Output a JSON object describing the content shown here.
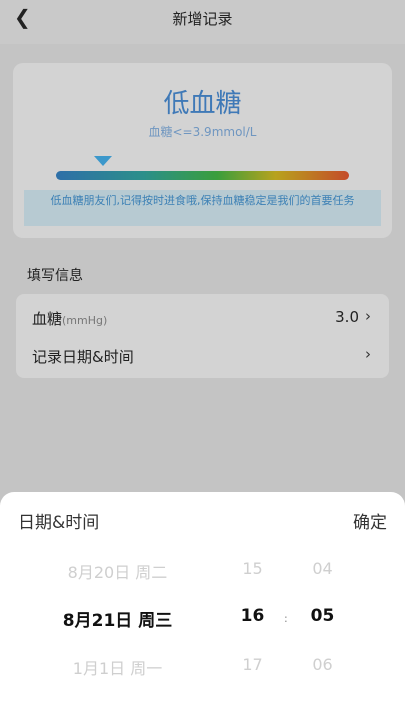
{
  "header": {
    "back_icon": "back-arrow-icon",
    "title": "新增记录"
  },
  "status": {
    "title": "低血糖",
    "range": "血糖<=3.9mmol/L",
    "tip": "低血糖朋友们,记得按时进食哦,保持血糖稳定是我们的首要任务",
    "level_fraction": 0.16
  },
  "form": {
    "section_label": "填写信息",
    "glucose_label": "血糖",
    "glucose_unit": "(mmHg)",
    "glucose_value": "3.0",
    "date_label": "记录日期&时间"
  },
  "sheet": {
    "title": "日期&时间",
    "confirm": "确定",
    "date": {
      "prev": "8月20日 周二",
      "selected": "8月21日 周三",
      "next": "1月1日 周一"
    },
    "hour": {
      "prev": "15",
      "selected": "16",
      "next": "17"
    },
    "minute": {
      "prev": "04",
      "selected": "05",
      "next": "06"
    },
    "separator": ":"
  }
}
